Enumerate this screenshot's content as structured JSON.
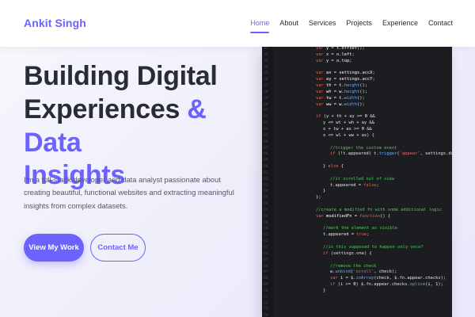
{
  "brand": "Ankit Singh",
  "nav": [
    {
      "label": "Home",
      "active": true
    },
    {
      "label": "About",
      "active": false
    },
    {
      "label": "Services",
      "active": false
    },
    {
      "label": "Projects",
      "active": false
    },
    {
      "label": "Experience",
      "active": false
    },
    {
      "label": "Contact",
      "active": false
    }
  ],
  "hero": {
    "title_line1": "Building Digital",
    "title_line2_plain": "Experiences ",
    "title_line2_accent": "& Data",
    "title_line3_accent": "Insights",
    "description": "I'm a full-stack developer and data analyst passionate about creating beautiful, functional websites and extracting meaningful insights from complex datasets.",
    "primary_button": "View My Work",
    "secondary_button": "Contact Me"
  },
  "colors": {
    "accent": "#6c63ff",
    "text_dark": "#2a2b38",
    "code_bg": "#1c1d21"
  },
  "code": [
    {
      "indent": 0,
      "tokens": [
        [
          "c-pl",
          "    "
        ],
        [
          "c-kw",
          "var "
        ],
        [
          "c-var",
          "y "
        ],
        [
          "c-pl",
          "= "
        ],
        [
          "c-var",
          "t.offset"
        ],
        [
          "c-pl",
          "();"
        ]
      ]
    },
    {
      "indent": 0,
      "tokens": [
        [
          "c-kw",
          "var "
        ],
        [
          "c-var",
          "x "
        ],
        [
          "c-pl",
          "= "
        ],
        [
          "c-var",
          "o.left"
        ],
        [
          "c-pl",
          ";"
        ]
      ]
    },
    {
      "indent": 0,
      "tokens": [
        [
          "c-kw",
          "var "
        ],
        [
          "c-var",
          "y "
        ],
        [
          "c-pl",
          "= "
        ],
        [
          "c-var",
          "o.top"
        ],
        [
          "c-pl",
          ";"
        ]
      ]
    },
    {
      "indent": 0,
      "tokens": []
    },
    {
      "indent": 0,
      "tokens": [
        [
          "c-kw",
          "var "
        ],
        [
          "c-var",
          "ax "
        ],
        [
          "c-pl",
          "= "
        ],
        [
          "c-var",
          "settings.accX"
        ],
        [
          "c-pl",
          ";"
        ]
      ]
    },
    {
      "indent": 0,
      "tokens": [
        [
          "c-kw",
          "var "
        ],
        [
          "c-var",
          "ay "
        ],
        [
          "c-pl",
          "= "
        ],
        [
          "c-var",
          "settings.accY"
        ],
        [
          "c-pl",
          ";"
        ]
      ]
    },
    {
      "indent": 0,
      "tokens": [
        [
          "c-kw",
          "var "
        ],
        [
          "c-var",
          "th "
        ],
        [
          "c-pl",
          "= "
        ],
        [
          "c-var",
          "t."
        ],
        [
          "c-fn",
          "height"
        ],
        [
          "c-pl",
          "();"
        ]
      ]
    },
    {
      "indent": 0,
      "tokens": [
        [
          "c-kw",
          "var "
        ],
        [
          "c-var",
          "wh "
        ],
        [
          "c-pl",
          "= "
        ],
        [
          "c-var",
          "w."
        ],
        [
          "c-fn",
          "height"
        ],
        [
          "c-pl",
          "();"
        ]
      ]
    },
    {
      "indent": 0,
      "tokens": [
        [
          "c-kw",
          "var "
        ],
        [
          "c-var",
          "tw "
        ],
        [
          "c-pl",
          "= "
        ],
        [
          "c-var",
          "t."
        ],
        [
          "c-fn",
          "width"
        ],
        [
          "c-pl",
          "();"
        ]
      ]
    },
    {
      "indent": 0,
      "tokens": [
        [
          "c-kw",
          "var "
        ],
        [
          "c-var",
          "ww "
        ],
        [
          "c-pl",
          "= "
        ],
        [
          "c-var",
          "w."
        ],
        [
          "c-fn",
          "width"
        ],
        [
          "c-pl",
          "();"
        ]
      ]
    },
    {
      "indent": 0,
      "tokens": []
    },
    {
      "indent": 0,
      "tokens": [
        [
          "c-kw",
          "if "
        ],
        [
          "c-pl",
          "(y + th + ay >= "
        ],
        [
          "c-var",
          "0 "
        ],
        [
          "c-pl",
          "&&"
        ]
      ]
    },
    {
      "indent": 1,
      "tokens": [
        [
          "c-pl",
          "  y <= wt + wh + ay &&"
        ]
      ]
    },
    {
      "indent": 1,
      "tokens": [
        [
          "c-pl",
          "  x + tw + ax >= "
        ],
        [
          "c-var",
          "0 "
        ],
        [
          "c-pl",
          "&&"
        ]
      ]
    },
    {
      "indent": 1,
      "tokens": [
        [
          "c-pl",
          "  x <= wl + ww + ax) {"
        ]
      ]
    },
    {
      "indent": 0,
      "tokens": []
    },
    {
      "indent": 2,
      "tokens": [
        [
          "c-cm",
          "    //trigger the custom event"
        ]
      ]
    },
    {
      "indent": 2,
      "tokens": [
        [
          "c-pl",
          "    "
        ],
        [
          "c-kw",
          "if "
        ],
        [
          "c-pl",
          "(!t.appeared) t."
        ],
        [
          "c-fn",
          "trigger"
        ],
        [
          "c-pl",
          "("
        ],
        [
          "c-str",
          "'appear'"
        ],
        [
          "c-pl",
          ", settings.data);"
        ]
      ]
    },
    {
      "indent": 0,
      "tokens": []
    },
    {
      "indent": 1,
      "tokens": [
        [
          "c-pl",
          "  } "
        ],
        [
          "c-kw",
          "else "
        ],
        [
          "c-pl",
          "{"
        ]
      ]
    },
    {
      "indent": 0,
      "tokens": []
    },
    {
      "indent": 2,
      "tokens": [
        [
          "c-cm",
          "    //it scrolled out of view"
        ]
      ]
    },
    {
      "indent": 2,
      "tokens": [
        [
          "c-pl",
          "    t.appeared = "
        ],
        [
          "c-kw",
          "false"
        ],
        [
          "c-pl",
          ";"
        ]
      ]
    },
    {
      "indent": 1,
      "tokens": [
        [
          "c-pl",
          "  }"
        ]
      ]
    },
    {
      "indent": 0,
      "tokens": [
        [
          "c-pl",
          "};"
        ]
      ]
    },
    {
      "indent": 0,
      "tokens": []
    },
    {
      "indent": 0,
      "tokens": [
        [
          "c-cm",
          "//create a modified fn with some additional logic"
        ]
      ]
    },
    {
      "indent": 0,
      "tokens": [
        [
          "c-kw",
          "var "
        ],
        [
          "c-var",
          "modifiedFn "
        ],
        [
          "c-pl",
          "= "
        ],
        [
          "c-kw",
          "function"
        ],
        [
          "c-pl",
          "() {"
        ]
      ]
    },
    {
      "indent": 0,
      "tokens": []
    },
    {
      "indent": 1,
      "tokens": [
        [
          "c-cm",
          "  //mark the element as visible"
        ]
      ]
    },
    {
      "indent": 1,
      "tokens": [
        [
          "c-pl",
          "  t.appeared = "
        ],
        [
          "c-kw",
          "true"
        ],
        [
          "c-pl",
          ";"
        ]
      ]
    },
    {
      "indent": 0,
      "tokens": []
    },
    {
      "indent": 1,
      "tokens": [
        [
          "c-cm",
          "  //is this supposed to happen only once?"
        ]
      ]
    },
    {
      "indent": 1,
      "tokens": [
        [
          "c-pl",
          "  "
        ],
        [
          "c-kw",
          "if "
        ],
        [
          "c-pl",
          "(settings.one) {"
        ]
      ]
    },
    {
      "indent": 0,
      "tokens": []
    },
    {
      "indent": 2,
      "tokens": [
        [
          "c-cm",
          "    //remove the check"
        ]
      ]
    },
    {
      "indent": 2,
      "tokens": [
        [
          "c-pl",
          "    w."
        ],
        [
          "c-fn",
          "unbind"
        ],
        [
          "c-pl",
          "("
        ],
        [
          "c-str",
          "'scroll'"
        ],
        [
          "c-pl",
          ", check);"
        ]
      ]
    },
    {
      "indent": 2,
      "tokens": [
        [
          "c-pl",
          "    "
        ],
        [
          "c-kw",
          "var "
        ],
        [
          "c-var",
          "i "
        ],
        [
          "c-pl",
          "= $."
        ],
        [
          "c-fn",
          "inArray"
        ],
        [
          "c-pl",
          "(check, $.fn.appear.checks);"
        ]
      ]
    },
    {
      "indent": 2,
      "tokens": [
        [
          "c-pl",
          "    "
        ],
        [
          "c-kw",
          "if "
        ],
        [
          "c-pl",
          "(i >= "
        ],
        [
          "c-var",
          "0"
        ],
        [
          "c-pl",
          ") $.fn.appear.checks."
        ],
        [
          "c-fn",
          "splice"
        ],
        [
          "c-pl",
          "(i, 1);"
        ]
      ]
    },
    {
      "indent": 1,
      "tokens": [
        [
          "c-pl",
          "  }"
        ]
      ]
    },
    {
      "indent": 0,
      "tokens": []
    },
    {
      "indent": 0,
      "tokens": []
    },
    {
      "indent": 0,
      "tokens": []
    },
    {
      "indent": 0,
      "tokens": []
    }
  ]
}
